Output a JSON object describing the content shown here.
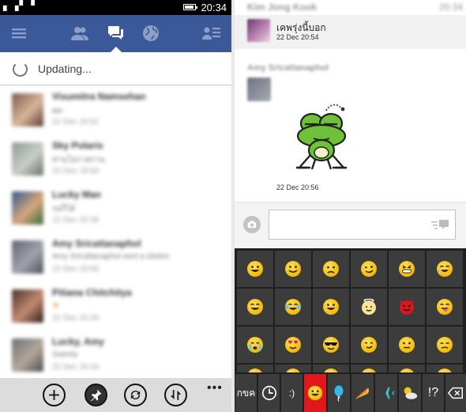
{
  "left_panel": {
    "status_bar": {
      "signal": "▖▗▘▝",
      "time": "20:34"
    },
    "nav": {
      "icons": [
        {
          "name": "menu-icon",
          "active": false
        },
        {
          "name": "friend-requests-icon",
          "active": false
        },
        {
          "name": "messages-icon",
          "active": true
        },
        {
          "name": "notifications-globe-icon",
          "active": false
        },
        {
          "name": "contacts-icon",
          "active": false
        }
      ]
    },
    "updating_label": "Updating...",
    "conversations": [
      {
        "name": "Visumitra Namsehan",
        "snippet": "ดด",
        "date": "22 Dec 20:51"
      },
      {
        "name": "Sky Polaris",
        "snippet": "ท่านโอกาสกาน",
        "date": "22 Dec 19:50"
      },
      {
        "name": "Lucky Man",
        "snippet": "รอก็ได้",
        "date": "22 Dec 20:36"
      },
      {
        "name": "Amy Sricattanaphol",
        "snippet": "Amy Sricattanaphol sent a sticker.",
        "date": "22 Dec 20:56"
      },
      {
        "name": "Pitiana Chitchitya",
        "snippet": "★",
        "date": "22 Dec 20:34"
      },
      {
        "name": "Lucky, Amy",
        "snippet": "Sweety",
        "date": "22 Dec 20:43"
      }
    ],
    "app_bar": {
      "more_label": "•••"
    }
  },
  "right_panel": {
    "status_bar": {
      "sender": "Kim Jong Kook",
      "time": "20:34"
    },
    "message1": {
      "text": "เคพรุ่งนี้บอก",
      "date": "22 Dec 20:54"
    },
    "message2": {
      "sender": "Amy Sricattanaphol",
      "date": "22 Dec 20:56"
    },
    "composer": {
      "value": ""
    },
    "keyboard": {
      "emoji_grid": [
        [
          "grin",
          "smile",
          "frown",
          "wink",
          "grin-teeth",
          "cry-smile"
        ],
        [
          "laugh",
          "tears-of-joy",
          "grin",
          "angel",
          "devil",
          "tongue"
        ],
        [
          "tears",
          "heart-eyes",
          "cool",
          "smirk",
          "neutral",
          "unamused"
        ]
      ],
      "categories": [
        {
          "label": "กขค",
          "name": "thai-keyboard-key"
        },
        {
          "label": "",
          "name": "recent-clock-icon"
        },
        {
          "label": ":)",
          "name": "text-emoticon-key"
        },
        {
          "label": "",
          "name": "emoji-category-icon",
          "active": true
        },
        {
          "label": "",
          "name": "balloon-category-icon"
        },
        {
          "label": "",
          "name": "food-category-icon"
        },
        {
          "label": "",
          "name": "airplane-category-icon"
        },
        {
          "label": "",
          "name": "weather-category-icon"
        },
        {
          "label": "!?",
          "name": "symbols-key"
        },
        {
          "label": "",
          "name": "backspace-icon"
        }
      ]
    }
  },
  "colors": {
    "facebook_blue": "#3b5998",
    "emoji_yellow": "#f5c518",
    "key_bg": "#3c3c3c",
    "active_key": "#e2171c"
  }
}
